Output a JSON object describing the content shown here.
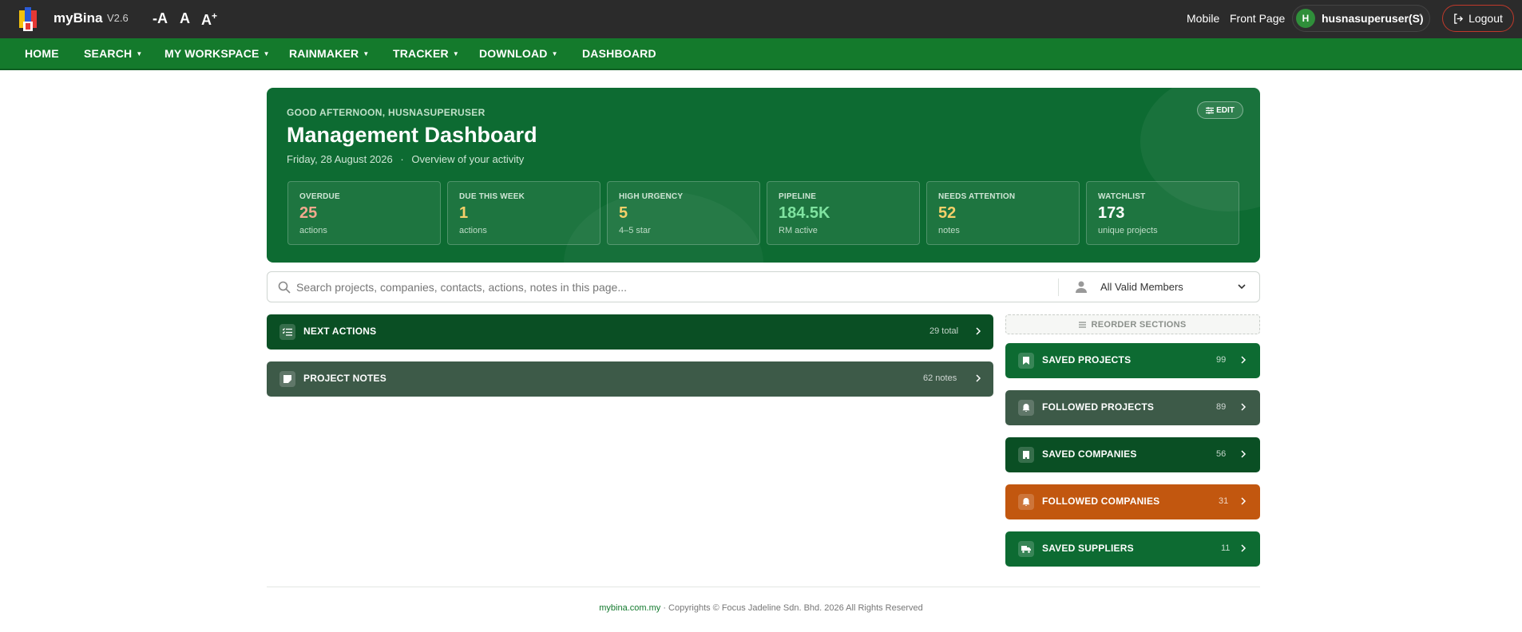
{
  "app": {
    "name": "myBina",
    "version": "V2.6"
  },
  "font_controls": {
    "decrease": "-A",
    "normal": "A",
    "increase": "A",
    "increase_plus": "+"
  },
  "top_links": {
    "mobile": "Mobile",
    "front_page": "Front Page"
  },
  "user": {
    "initial": "H",
    "name": "husnasuperuser(S)"
  },
  "logout_label": "Logout",
  "nav": {
    "home": "HOME",
    "search": "SEARCH",
    "my_workspace": "MY WORKSPACE",
    "rainmaker": "RAINMAKER",
    "tracker": "TRACKER",
    "download": "DOWNLOAD",
    "dashboard": "DASHBOARD"
  },
  "hero": {
    "greeting": "GOOD AFTERNOON, HUSNASUPERUSER",
    "title": "Management Dashboard",
    "date": "Friday, 28 August 2026",
    "separator": "·",
    "subtitle": "Overview of your activity",
    "edit_label": "EDIT",
    "stats": [
      {
        "label": "OVERDUE",
        "value": "25",
        "unit": "actions",
        "color": "#f2a98e"
      },
      {
        "label": "DUE THIS WEEK",
        "value": "1",
        "unit": "actions",
        "color": "#f5d06a"
      },
      {
        "label": "HIGH URGENCY",
        "value": "5",
        "unit": "4–5 star",
        "color": "#f5d06a"
      },
      {
        "label": "PIPELINE",
        "value": "184.5K",
        "unit": "RM active",
        "color": "#7fe3a0"
      },
      {
        "label": "NEEDS ATTENTION",
        "value": "52",
        "unit": "notes",
        "color": "#f5d06a"
      },
      {
        "label": "WATCHLIST",
        "value": "173",
        "unit": "unique projects",
        "color": "#ffffff"
      }
    ]
  },
  "search": {
    "placeholder": "Search projects, companies, contacts, actions, notes in this page...",
    "member_filter": "All Valid Members"
  },
  "left_sections": [
    {
      "title": "NEXT ACTIONS",
      "count": "29 total",
      "color": "#0a4f24"
    },
    {
      "title": "PROJECT NOTES",
      "count": "62 notes",
      "color": "#3d5a48"
    }
  ],
  "reorder_label": "REORDER SECTIONS",
  "right_sections": [
    {
      "title": "SAVED PROJECTS",
      "count": "99",
      "color": "#0d6b32"
    },
    {
      "title": "FOLLOWED PROJECTS",
      "count": "89",
      "color": "#3d5a48"
    },
    {
      "title": "SAVED COMPANIES",
      "count": "56",
      "color": "#0a4f24"
    },
    {
      "title": "FOLLOWED COMPANIES",
      "count": "31",
      "color": "#c2570f"
    },
    {
      "title": "SAVED SUPPLIERS",
      "count": "11",
      "color": "#0d6b32"
    }
  ],
  "footer": {
    "site": "mybina.com.my",
    "text": " · Copyrights © Focus Jadeline Sdn. Bhd. 2026 All Rights Reserved"
  }
}
